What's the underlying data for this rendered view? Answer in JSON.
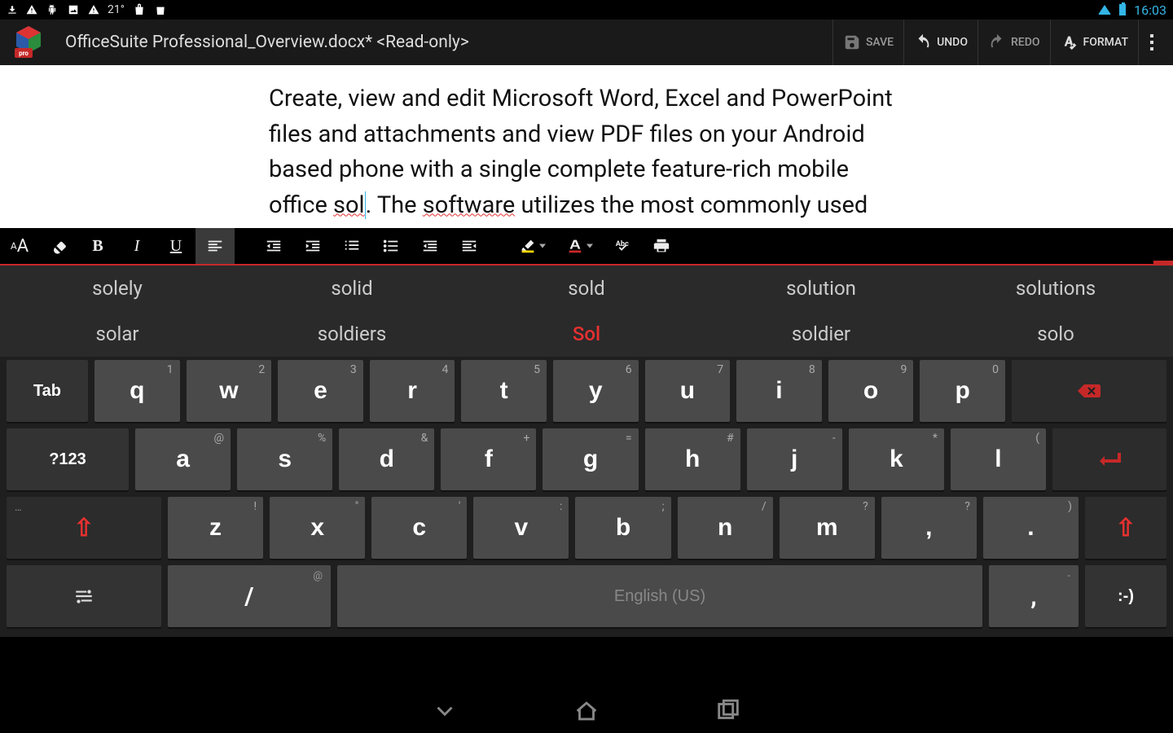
{
  "status": {
    "time": "16:03",
    "temp": "21°"
  },
  "appbar": {
    "title": "OfficeSuite Professional_Overview.docx* <Read-only>",
    "save": "SAVE",
    "undo": "UNDO",
    "redo": "REDO",
    "format": "FORMAT"
  },
  "document": {
    "text1": "Create, view and edit Microsoft Word, Excel and PowerPoint files and attachments and view PDF files on your Android based  phone with a single complete feature-rich mobile office ",
    "err1": "sol",
    "text2": ". The ",
    "err2": "software",
    "text3": " utilizes the most commonly used desktop document formats and also includes a "
  },
  "suggestions": {
    "row1": [
      "solely",
      "solid",
      "sold",
      "solution",
      "solutions"
    ],
    "row2": [
      "solar",
      "soldiers",
      "Sol",
      "soldier",
      "solo"
    ],
    "highlight": "Sol"
  },
  "keyboard": {
    "row1": [
      {
        "k": "q",
        "h": "1"
      },
      {
        "k": "w",
        "h": "2"
      },
      {
        "k": "e",
        "h": "3"
      },
      {
        "k": "r",
        "h": "4"
      },
      {
        "k": "t",
        "h": "5"
      },
      {
        "k": "y",
        "h": "6"
      },
      {
        "k": "u",
        "h": "7"
      },
      {
        "k": "i",
        "h": "8"
      },
      {
        "k": "o",
        "h": "9"
      },
      {
        "k": "p",
        "h": "0"
      }
    ],
    "row2": [
      {
        "k": "a",
        "h": "@"
      },
      {
        "k": "s",
        "h": "%"
      },
      {
        "k": "d",
        "h": "&"
      },
      {
        "k": "f",
        "h": "+"
      },
      {
        "k": "g",
        "h": "="
      },
      {
        "k": "h",
        "h": "#"
      },
      {
        "k": "j",
        "h": "-"
      },
      {
        "k": "k",
        "h": "*"
      },
      {
        "k": "l",
        "h": "("
      }
    ],
    "row3": [
      {
        "k": "z",
        "h": "!"
      },
      {
        "k": "x",
        "h": "\""
      },
      {
        "k": "c",
        "h": "'"
      },
      {
        "k": "v",
        "h": ":"
      },
      {
        "k": "b",
        "h": ";"
      },
      {
        "k": "n",
        "h": "/"
      },
      {
        "k": "m",
        "h": "?"
      },
      {
        "k": ",",
        "h": "?"
      },
      {
        "k": ".",
        "h": ")"
      }
    ],
    "tab": "Tab",
    "sym": "?123",
    "slash": "/",
    "slash_h": "@",
    "space": "English (US)",
    "comma": ",",
    "comma_h": "-",
    "smile": ":-)"
  }
}
